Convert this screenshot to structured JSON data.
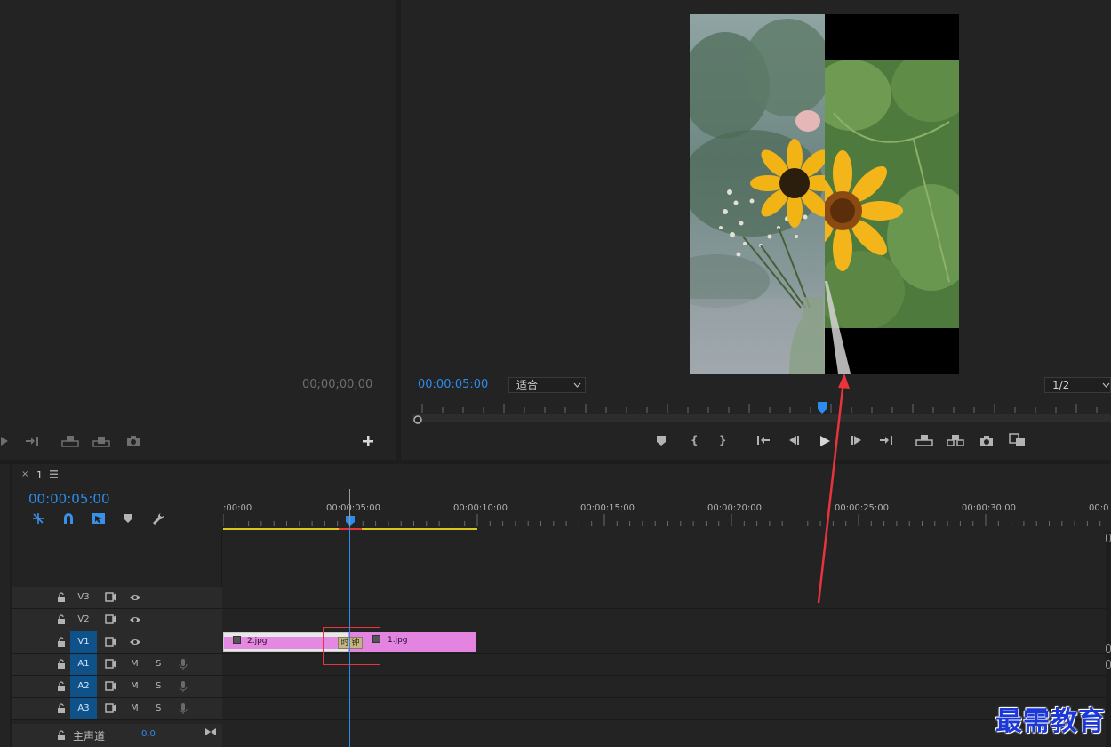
{
  "source_monitor": {
    "timecode": "00;00;00;00"
  },
  "program_monitor": {
    "timecode": "00:00:05:00",
    "fit_select": "适合",
    "resolution_select": "1/2"
  },
  "timeline": {
    "sequence_name": "1",
    "timecode": "00:00:05:00",
    "ruler_labels": [
      ":00:00",
      "00:00:05:00",
      "00:00:10:00",
      "00:00:15:00",
      "00:00:20:00",
      "00:00:25:00",
      "00:00:30:00",
      "00:0"
    ],
    "video_tracks": [
      {
        "name": "V3",
        "targeted": false
      },
      {
        "name": "V2",
        "targeted": false
      },
      {
        "name": "V1",
        "targeted": true
      }
    ],
    "audio_tracks": [
      {
        "name": "A1",
        "m": "M",
        "s": "S"
      },
      {
        "name": "A2",
        "m": "M",
        "s": "S"
      },
      {
        "name": "A3",
        "m": "M",
        "s": "S"
      }
    ],
    "master": {
      "label": "主声道",
      "value": "0.0"
    },
    "clips": [
      {
        "name": "2.jpg"
      },
      {
        "name": "1.jpg"
      }
    ],
    "transition_label": "时 钟"
  },
  "watermark": "最需教育",
  "colors": {
    "accent_blue": "#2d8ceb",
    "clip_pink": "#e484e1",
    "target_blue": "#0f5289",
    "annotation_red": "#e8343a",
    "work_area_yellow": "#d9c51b"
  }
}
